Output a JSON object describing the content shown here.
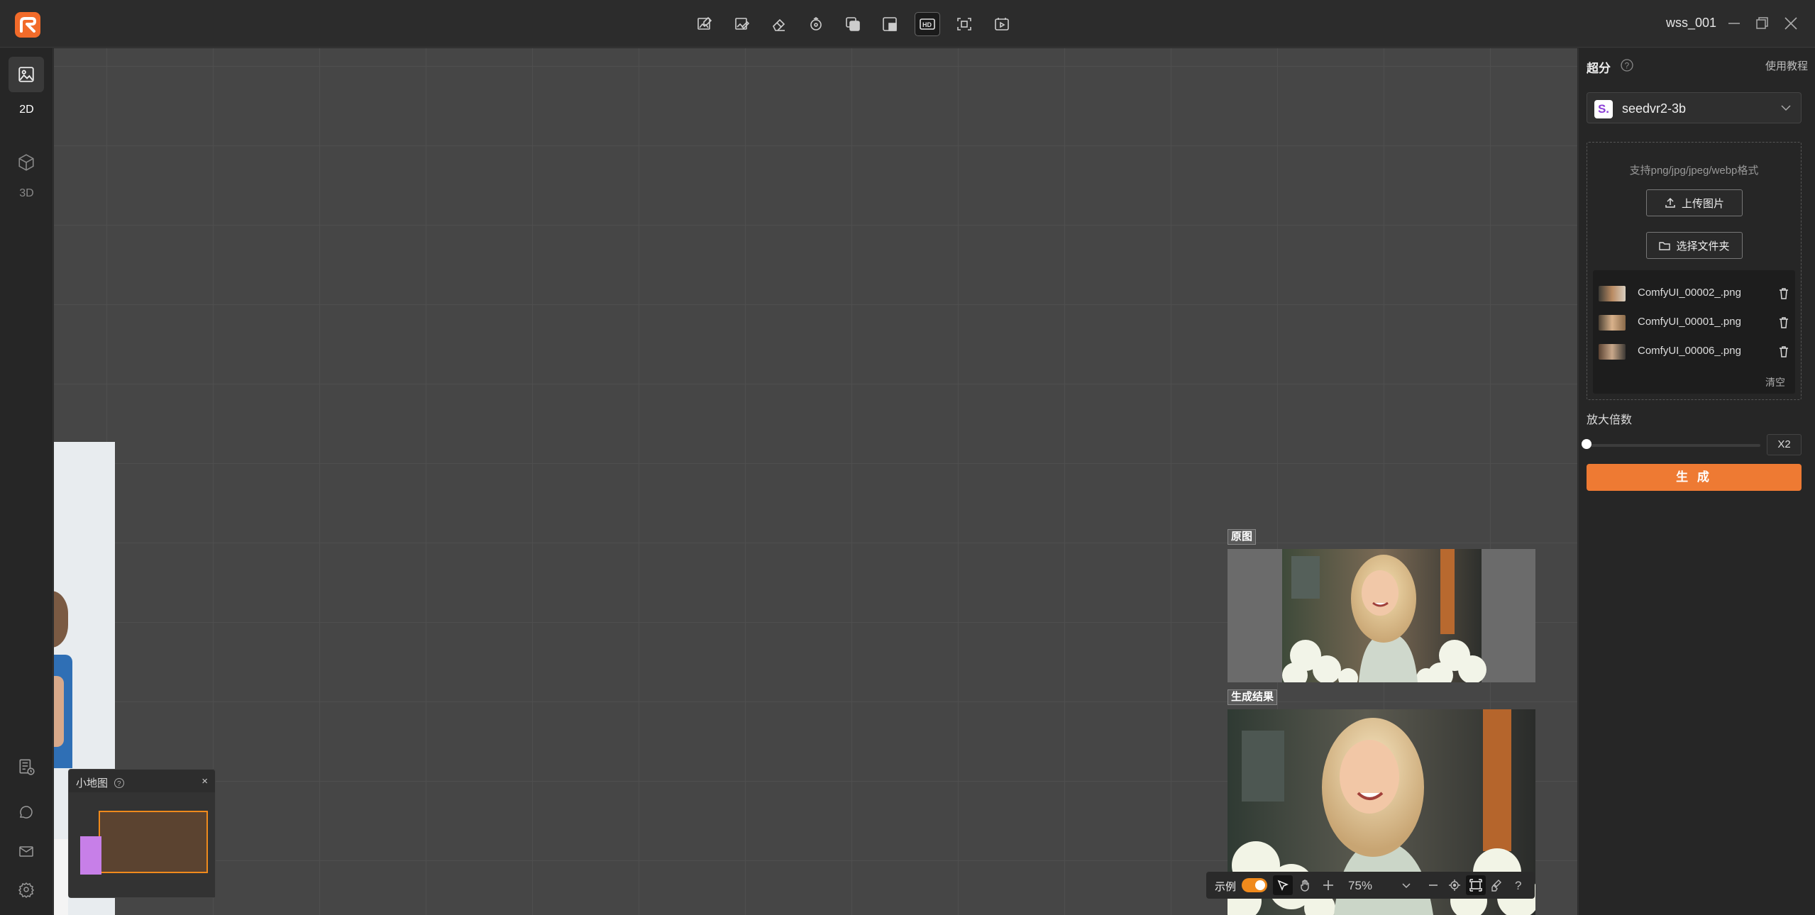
{
  "app": {
    "user": "wss_001"
  },
  "toolbar": {
    "tools": [
      "image-edit-icon",
      "image-brush-icon",
      "eraser-icon",
      "rotate-icon",
      "layers-icon",
      "crop-icon",
      "hd-upscale-icon",
      "focus-frame-icon",
      "video-play-icon"
    ],
    "active_tool": "hd-upscale-icon"
  },
  "rail": {
    "top": [
      {
        "icon": "image-icon",
        "label": "2D"
      },
      {
        "icon": "cube-icon",
        "label": "3D"
      }
    ],
    "bottom": [
      "history-icon",
      "chat-icon",
      "mail-icon",
      "settings-icon"
    ]
  },
  "canvas": {
    "original_label": "原图",
    "result_label": "生成结果"
  },
  "minimap": {
    "title": "小地图",
    "close": "×"
  },
  "bottombar": {
    "demo_label": "示例",
    "demo_on": true,
    "zoom": "75%"
  },
  "panel": {
    "title": "超分",
    "tutorial": "使用教程",
    "model": {
      "logo": "S.",
      "name": "seedvr2-3b"
    },
    "upload_hint": "支持png/jpg/jpeg/webp格式",
    "upload_button": "上传图片",
    "folder_button": "选择文件夹",
    "files": [
      {
        "name": "ComfyUI_00002_.png"
      },
      {
        "name": "ComfyUI_00001_.png"
      },
      {
        "name": "ComfyUI_00006_.png"
      }
    ],
    "clear": "清空",
    "scale_label": "放大倍数",
    "scale_value": "X2",
    "generate": "生 成"
  },
  "colors": {
    "accent": "#ee7a33",
    "brand": "#f26b2a",
    "canvas": "#464646"
  }
}
